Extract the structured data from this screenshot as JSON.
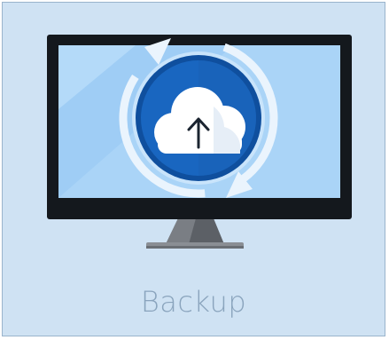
{
  "tile": {
    "label": "Backup",
    "icon": "monitor-cloud-upload-sync-icon"
  },
  "colors": {
    "tile_background": "#cfe2f3",
    "tile_border": "#9ab4cc",
    "label_text": "#8aa4bd",
    "monitor_bezel": "#14181d",
    "screen": "#9fcdf5",
    "cloud_circle": "#1966c0",
    "sync_arrows": "#ffffff"
  }
}
